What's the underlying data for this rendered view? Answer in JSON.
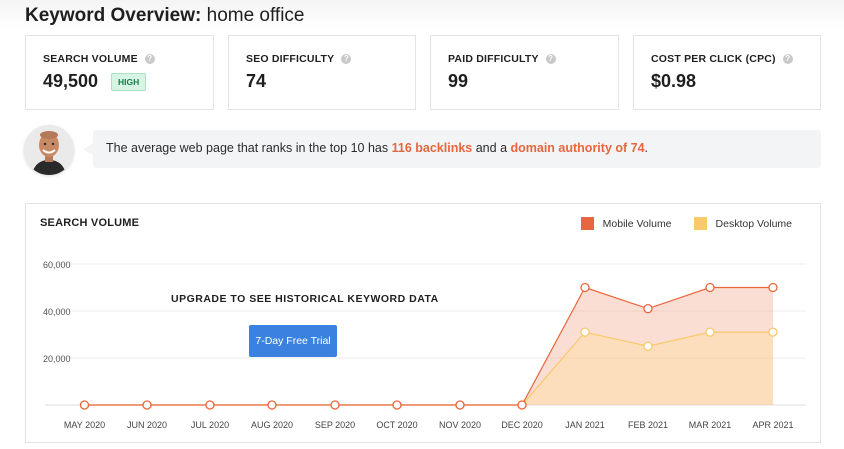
{
  "header": {
    "title_bold": "Keyword Overview:",
    "title_keyword": "home office"
  },
  "metrics": [
    {
      "label": "SEARCH VOLUME",
      "value": "49,500",
      "badge": "HIGH"
    },
    {
      "label": "SEO DIFFICULTY",
      "value": "74"
    },
    {
      "label": "PAID DIFFICULTY",
      "value": "99"
    },
    {
      "label": "COST PER CLICK (CPC)",
      "value": "$0.98"
    }
  ],
  "insight": {
    "prefix": "The average web page that ranks in the top 10 has",
    "backlinks": "116 backlinks",
    "middle": "and a",
    "authority": "domain authority of 74",
    "suffix": "."
  },
  "chart": {
    "title": "SEARCH VOLUME",
    "upgrade_text": "UPGRADE TO SEE HISTORICAL KEYWORD DATA",
    "trial_button": "7-Day Free Trial"
  },
  "colors": {
    "mobile": "#e8663d",
    "desktop": "#f9c96b",
    "accent": "#3b82e0"
  },
  "chart_data": {
    "type": "area",
    "categories": [
      "MAY 2020",
      "JUN 2020",
      "JUL 2020",
      "AUG 2020",
      "SEP 2020",
      "OCT 2020",
      "NOV 2020",
      "DEC 2020",
      "JAN 2021",
      "FEB 2021",
      "MAR 2021",
      "APR 2021"
    ],
    "series": [
      {
        "name": "Mobile Volume",
        "values": [
          0,
          0,
          0,
          0,
          0,
          0,
          0,
          0,
          50000,
          41000,
          50000,
          50000
        ]
      },
      {
        "name": "Desktop Volume",
        "values": [
          0,
          0,
          0,
          0,
          0,
          0,
          0,
          0,
          31000,
          25000,
          31000,
          31000
        ]
      }
    ],
    "yticks": [
      "20,000",
      "40,000",
      "60,000"
    ],
    "ytick_values": [
      20000,
      40000,
      60000
    ],
    "ylim": [
      0,
      60000
    ],
    "grid": true,
    "legend": "top-right"
  }
}
